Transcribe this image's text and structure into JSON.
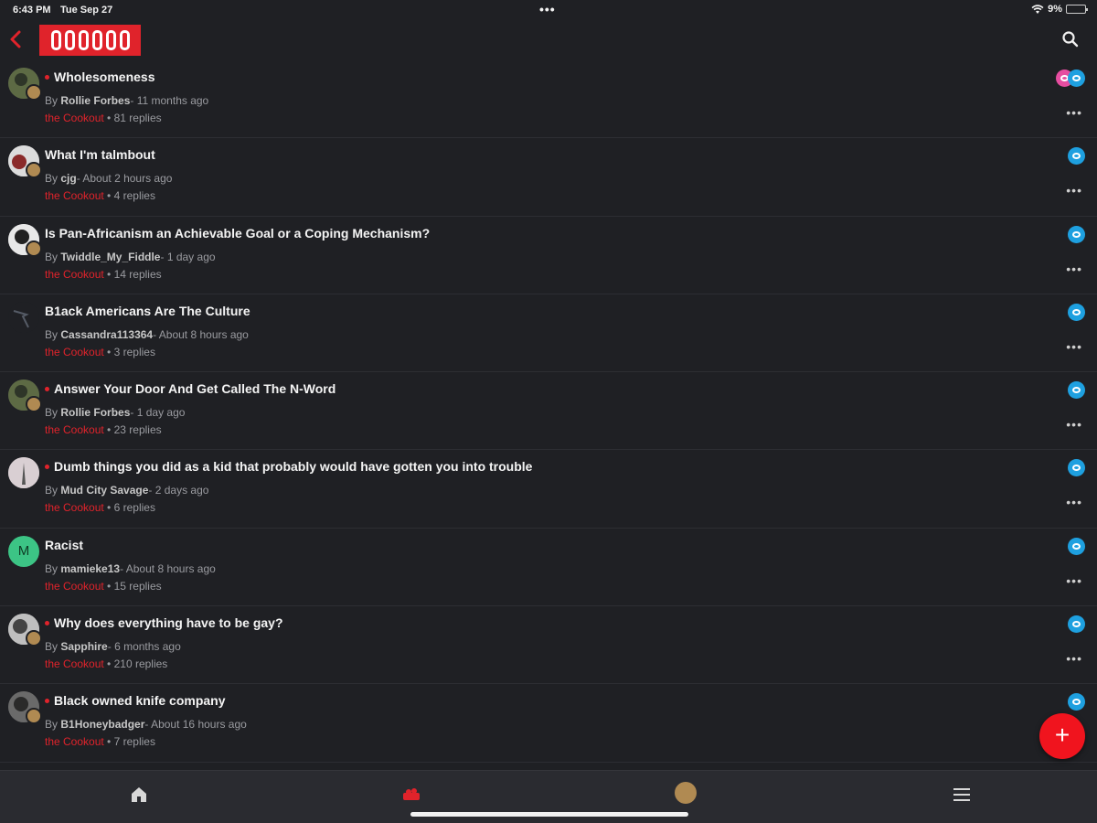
{
  "status_bar": {
    "time": "6:43 PM",
    "date": "Tue Sep 27",
    "dots": "•••",
    "battery": "9%"
  },
  "header": {
    "back_icon": "chevron-left-icon",
    "logo": "community-logo",
    "search_icon": "search-icon"
  },
  "topics": [
    {
      "title": "Wholesomeness",
      "unread": true,
      "author": "Rollie Forbes",
      "ago": "11 months ago",
      "category": "the Cookout",
      "replies": "81 replies",
      "avatar_letter": ""
    },
    {
      "title": "What I'm talmbout",
      "unread": false,
      "author": "cjg",
      "ago": "About 2 hours ago",
      "category": "the Cookout",
      "replies": "4 replies",
      "avatar_letter": ""
    },
    {
      "title": "Is Pan-Africanism an Achievable Goal or a Coping Mechanism?",
      "unread": false,
      "author": "Twiddle_My_Fiddle",
      "ago": "1 day ago",
      "category": "the Cookout",
      "replies": "14 replies",
      "avatar_letter": ""
    },
    {
      "title": "B1ack Americans Are The Culture",
      "unread": false,
      "author": "Cassandra113364",
      "ago": "About 8 hours ago",
      "category": "the Cookout",
      "replies": "3 replies",
      "avatar_letter": ""
    },
    {
      "title": "Answer Your Door And Get Called The N-Word",
      "unread": true,
      "author": "Rollie Forbes",
      "ago": "1 day ago",
      "category": "the Cookout",
      "replies": "23 replies",
      "avatar_letter": ""
    },
    {
      "title": "Dumb things you did as a kid that probably would have gotten you into trouble",
      "unread": true,
      "author": "Mud City Savage",
      "ago": "2 days ago",
      "category": "the Cookout",
      "replies": "6 replies",
      "avatar_letter": ""
    },
    {
      "title": "Racist",
      "unread": false,
      "author": "mamieke13",
      "ago": "About 8 hours ago",
      "category": "the Cookout",
      "replies": "15 replies",
      "avatar_letter": "M"
    },
    {
      "title": "Why does everything have to be gay?",
      "unread": true,
      "author": "Sapphire",
      "ago": "6 months ago",
      "category": "the Cookout",
      "replies": "210 replies",
      "avatar_letter": ""
    },
    {
      "title": "Black owned knife company",
      "unread": true,
      "author": "B1Honeybadger",
      "ago": "About 16 hours ago",
      "category": "the Cookout",
      "replies": "7 replies",
      "avatar_letter": ""
    }
  ],
  "meta": {
    "by": "By",
    "sep": "- ",
    "dot": " • "
  },
  "fab": {
    "label": "+"
  },
  "tabbar": {
    "home_icon": "home-icon",
    "community_icon": "community-icon",
    "profile_icon": "avatar",
    "menu_icon": "hamburger-menu-icon"
  },
  "colors": {
    "accent": "#e0232b",
    "background": "#1f2024",
    "watch": "#1ea0e0"
  }
}
